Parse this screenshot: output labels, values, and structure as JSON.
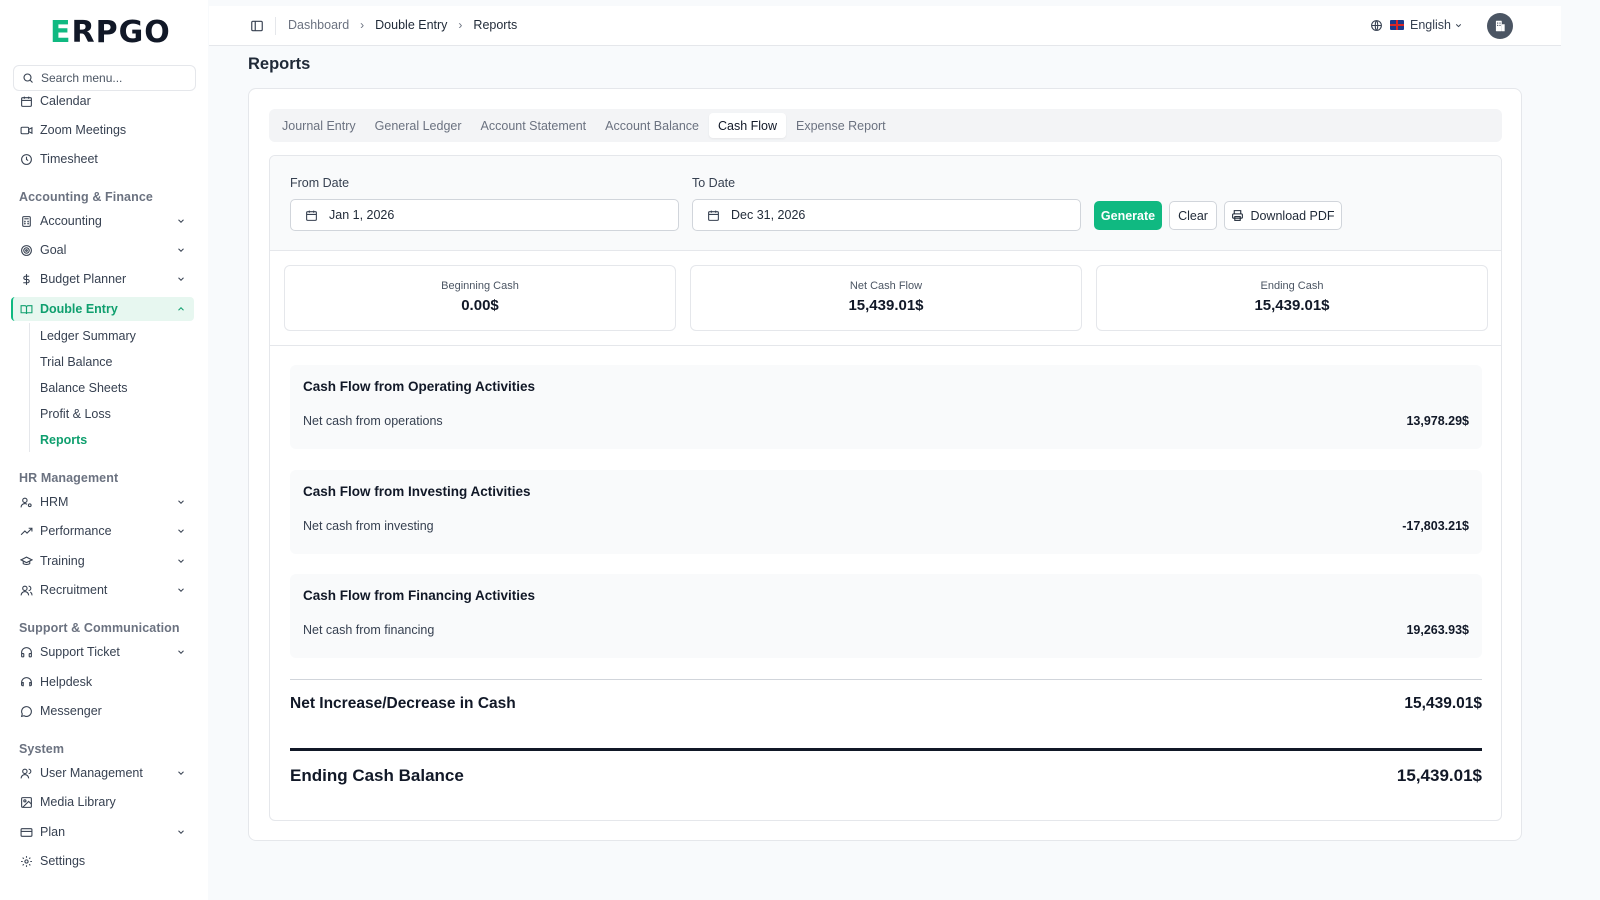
{
  "app": {
    "logo_first": "E",
    "logo_rest": "RPGO"
  },
  "sidebar": {
    "search_placeholder": "Search menu...",
    "items_top": [
      {
        "label": "Calendar",
        "icon": "calendar-icon"
      },
      {
        "label": "Zoom Meetings",
        "icon": "video-icon"
      },
      {
        "label": "Timesheet",
        "icon": "clock-icon"
      }
    ],
    "group_accounting": "Accounting & Finance",
    "accounting": [
      {
        "label": "Accounting",
        "icon": "calculator-icon"
      },
      {
        "label": "Goal",
        "icon": "target-icon"
      },
      {
        "label": "Budget Planner",
        "icon": "dollar-icon"
      },
      {
        "label": "Double Entry",
        "icon": "book-icon"
      }
    ],
    "double_entry_sub": [
      "Ledger Summary",
      "Trial Balance",
      "Balance Sheets",
      "Profit & Loss",
      "Reports"
    ],
    "group_hr": "HR Management",
    "hr": [
      {
        "label": "HRM",
        "icon": "user-cog-icon"
      },
      {
        "label": "Performance",
        "icon": "trending-up-icon"
      },
      {
        "label": "Training",
        "icon": "graduation-cap-icon"
      },
      {
        "label": "Recruitment",
        "icon": "users-icon"
      }
    ],
    "group_support": "Support & Communication",
    "support": [
      {
        "label": "Support Ticket",
        "icon": "headset-icon"
      },
      {
        "label": "Helpdesk",
        "icon": "headphones-icon"
      },
      {
        "label": "Messenger",
        "icon": "chat-icon"
      }
    ],
    "group_system": "System",
    "system": [
      {
        "label": "User Management",
        "icon": "user-icon"
      },
      {
        "label": "Media Library",
        "icon": "image-icon"
      },
      {
        "label": "Plan",
        "icon": "credit-card-icon"
      },
      {
        "label": "Settings",
        "icon": "gear-icon"
      }
    ]
  },
  "topbar": {
    "breadcrumb": [
      "Dashboard",
      "Double Entry",
      "Reports"
    ],
    "language": "English"
  },
  "main": {
    "title": "Reports",
    "tabs": [
      "Journal Entry",
      "General Ledger",
      "Account Statement",
      "Account Balance",
      "Cash Flow",
      "Expense Report"
    ],
    "active_tab": "Cash Flow",
    "filter": {
      "from_label": "From Date",
      "from_value": "Jan 1, 2026",
      "to_label": "To Date",
      "to_value": "Dec 31, 2026",
      "generate": "Generate",
      "clear": "Clear",
      "download": "Download PDF"
    },
    "summary": [
      {
        "label": "Beginning Cash",
        "value": "0.00$"
      },
      {
        "label": "Net Cash Flow",
        "value": "15,439.01$"
      },
      {
        "label": "Ending Cash",
        "value": "15,439.01$"
      }
    ],
    "sections": [
      {
        "title": "Cash Flow from Operating Activities",
        "label": "Net cash from operations",
        "value": "13,978.29$"
      },
      {
        "title": "Cash Flow from Investing Activities",
        "label": "Net cash from investing",
        "value": "-17,803.21$"
      },
      {
        "title": "Cash Flow from Financing Activities",
        "label": "Net cash from financing",
        "value": "19,263.93$"
      }
    ],
    "net_label": "Net Increase/Decrease in Cash",
    "net_value": "15,439.01$",
    "ending_label": "Ending Cash Balance",
    "ending_value": "15,439.01$"
  },
  "colors": {
    "accent": "#10b981",
    "accent_bg": "#e7f7f0",
    "text": "#1f2937"
  }
}
